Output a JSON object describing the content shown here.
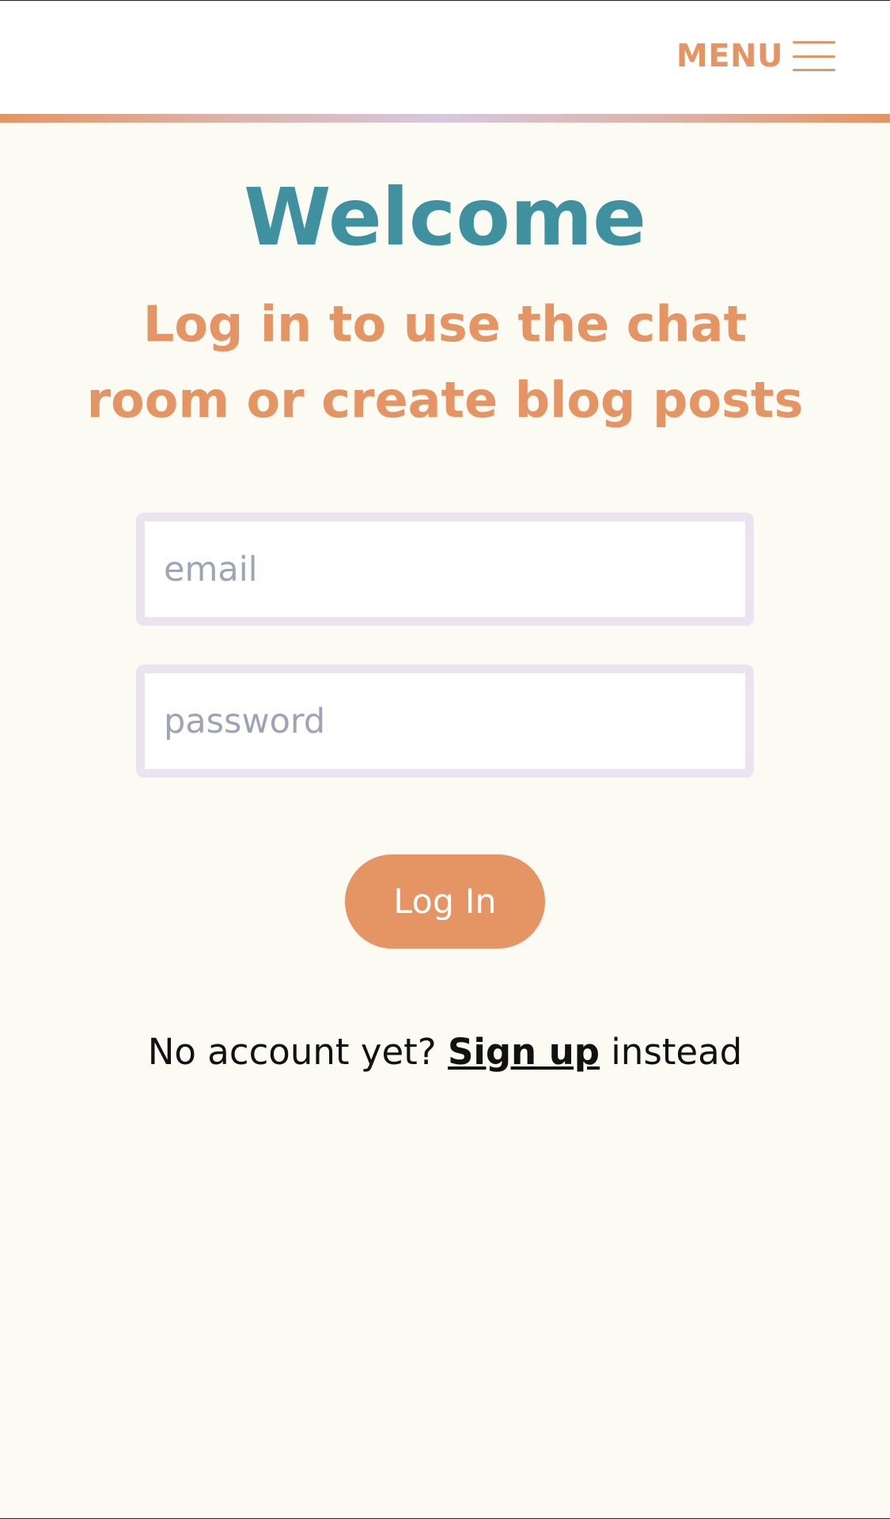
{
  "header": {
    "menu_label": "MENU",
    "menu_icon": "hamburger-icon"
  },
  "main": {
    "title": "Welcome",
    "subtitle": "Log in to use the chat room or create blog posts"
  },
  "form": {
    "email_placeholder": "email",
    "password_placeholder": "password",
    "submit_label": "Log In"
  },
  "signup": {
    "prefix": "No account yet?",
    "link_label": "Sign up",
    "suffix": "instead"
  },
  "colors": {
    "background": "#fbfaf3",
    "accent_orange": "#e59463",
    "title_teal": "#3f91a0",
    "input_border": "#ebe4f0",
    "placeholder": "#9ea3b5"
  }
}
